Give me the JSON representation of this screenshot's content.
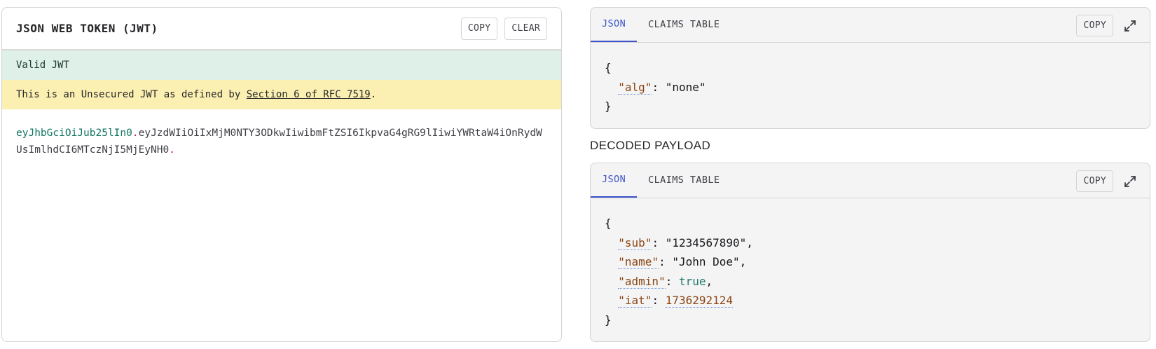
{
  "encoded": {
    "title": "JSON WEB TOKEN (JWT)",
    "copy_label": "COPY",
    "clear_label": "CLEAR",
    "status_valid": "Valid JWT",
    "warning_prefix": "This is an Unsecured JWT as defined by ",
    "warning_link": "Section 6 of RFC 7519",
    "warning_suffix": ".",
    "token_header": "eyJhbGciOiJub25lIn0",
    "token_payload": "eyJzdWIiOiIxMjM0NTY3ODkwIiwibmFtZSI6IkpvaG4gRG9lIiwiYWRtaW4iOnRydWUsImlhdCI6MTczNjI5MjEyNH0",
    "token_dot": "."
  },
  "header_panel": {
    "tab_json": "JSON",
    "tab_claims": "CLAIMS TABLE",
    "copy_label": "COPY",
    "open_brace": "{",
    "close_brace": "}",
    "alg_key": "\"alg\"",
    "alg_value": "\"none\""
  },
  "payload_section": {
    "title": "DECODED PAYLOAD"
  },
  "payload_panel": {
    "tab_json": "JSON",
    "tab_claims": "CLAIMS TABLE",
    "copy_label": "COPY",
    "open_brace": "{",
    "close_brace": "}",
    "sub_key": "\"sub\"",
    "sub_value": "\"1234567890\"",
    "name_key": "\"name\"",
    "name_value": "\"John Doe\"",
    "admin_key": "\"admin\"",
    "admin_value": "true",
    "iat_key": "\"iat\"",
    "iat_value": "1736292124"
  },
  "icons": {
    "expand": "expand-icon"
  },
  "colors": {
    "accent": "#3d54c9",
    "valid_bg": "#def0e7",
    "warning_bg": "#fbf0b1",
    "token_header": "#0f7660",
    "token_dot": "#c2185b",
    "json_key": "#8b4513",
    "json_bool": "#1f7a6b"
  }
}
